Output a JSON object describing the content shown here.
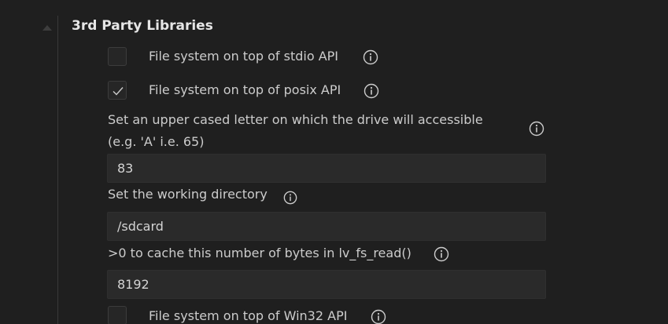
{
  "section": {
    "title": "3rd Party Libraries"
  },
  "settings": {
    "stdio": {
      "label": "File system on top of stdio API",
      "checked": false
    },
    "posix": {
      "label": "File system on top of posix API",
      "checked": true
    },
    "drive_letter": {
      "label_line1": "Set an upper cased letter on which the drive will accessible",
      "label_line2": "(e.g. 'A' i.e. 65)",
      "value": "83"
    },
    "working_dir": {
      "label": "Set the working directory",
      "value": "/sdcard"
    },
    "cache": {
      "label": ">0 to cache this number of bytes in lv_fs_read()",
      "value": "8192"
    },
    "win32": {
      "label": "File system on top of Win32 API",
      "checked": false
    }
  },
  "icons": {
    "collapse": "chevron-up-icon",
    "info": "info-icon",
    "check": "check-icon"
  },
  "colors": {
    "background": "#1f1f1f",
    "input_background": "#2a2a2a",
    "text": "#cccccc",
    "title": "#e6e6e6"
  }
}
